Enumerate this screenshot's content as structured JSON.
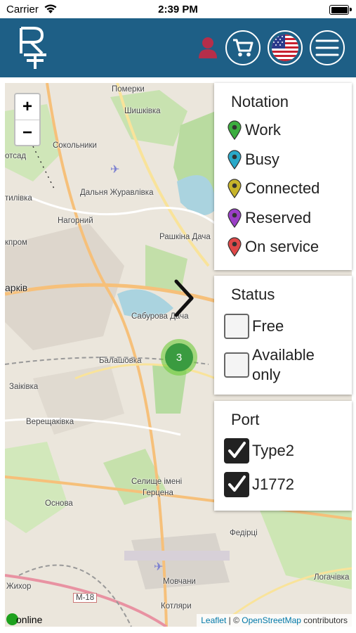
{
  "status_bar": {
    "carrier": "Carrier",
    "time": "2:39 PM"
  },
  "header": {
    "logo": "RT"
  },
  "map": {
    "labels": [
      "Померки",
      "Шишківка",
      "Сокольники",
      "Дальня Журавлівка",
      "отсад",
      "тилівка",
      "Нагорний",
      "Рашкіна Дача",
      "кпром",
      "арків",
      "Сабурова Дача",
      "Балашовка",
      "Заіківка",
      "Верещаківка",
      "Селище імені",
      "Герцена",
      "Основа",
      "Федірці",
      "Жихор",
      "Мовчани",
      "Котляри",
      "Логачівка",
      "М-18"
    ],
    "zoom_in": "+",
    "zoom_out": "−",
    "cluster_count": "3",
    "online_label": "online",
    "attribution": {
      "leaflet": "Leaflet",
      "sep": " | © ",
      "osm": "OpenStreetMap",
      "suffix": " contributors"
    }
  },
  "notation": {
    "title": "Notation",
    "items": [
      {
        "label": "Work",
        "color": "#3cae3f"
      },
      {
        "label": "Busy",
        "color": "#2aa9c9"
      },
      {
        "label": "Connected",
        "color": "#c7b42a"
      },
      {
        "label": "Reserved",
        "color": "#9b3fc7"
      },
      {
        "label": "On service",
        "color": "#e04848"
      }
    ]
  },
  "status_filter": {
    "title": "Status",
    "options": [
      {
        "label": "Free",
        "checked": false
      },
      {
        "label": "Available only",
        "checked": false
      }
    ]
  },
  "port_filter": {
    "title": "Port",
    "options": [
      {
        "label": "Type2",
        "checked": true
      },
      {
        "label": "J1772",
        "checked": true
      }
    ]
  }
}
